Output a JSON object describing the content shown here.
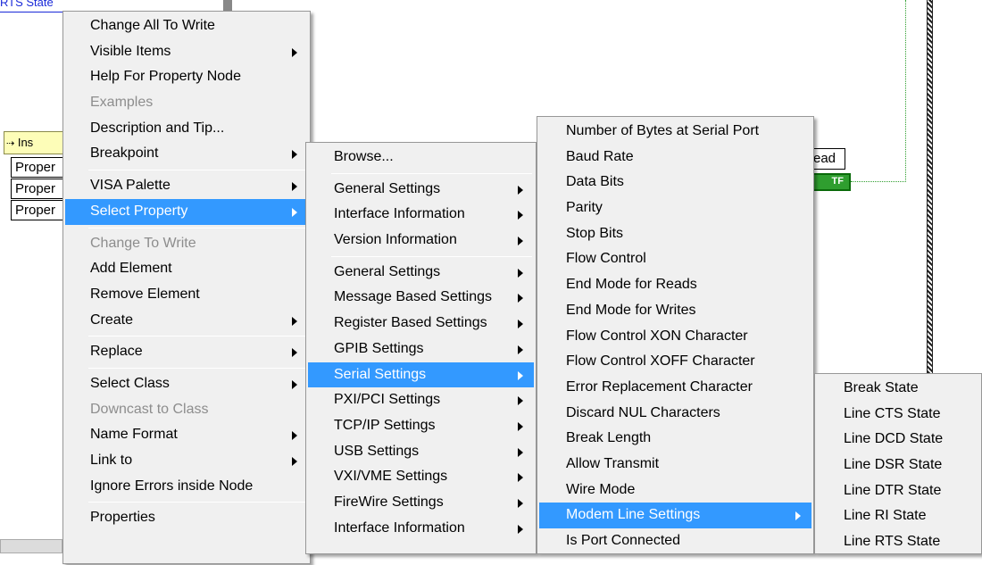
{
  "background": {
    "top_label": "RTS State",
    "node_header": "Ins",
    "node_header_glyph": "⇢",
    "property_rows": [
      "Proper",
      "Proper",
      "Proper"
    ],
    "read_label": "ead",
    "tf_label": "TF"
  },
  "main_menu": {
    "items": [
      {
        "label": "Change All To Write",
        "disabled": false
      },
      {
        "label": "Visible Items",
        "disabled": false,
        "submenu": true
      },
      {
        "label": "Help For Property Node",
        "disabled": false
      },
      {
        "label": "Examples",
        "disabled": true
      },
      {
        "label": "Description and Tip...",
        "disabled": false
      },
      {
        "label": "Breakpoint",
        "disabled": false,
        "submenu": true
      },
      {
        "sep": true
      },
      {
        "label": "VISA Palette",
        "disabled": false,
        "submenu": true
      },
      {
        "label": "Select Property",
        "disabled": false,
        "submenu": true,
        "selected": true
      },
      {
        "sep": true
      },
      {
        "label": "Change To Write",
        "disabled": true
      },
      {
        "label": "Add Element",
        "disabled": false
      },
      {
        "label": "Remove Element",
        "disabled": false
      },
      {
        "label": "Create",
        "disabled": false,
        "submenu": true
      },
      {
        "sep": true
      },
      {
        "label": "Replace",
        "disabled": false,
        "submenu": true
      },
      {
        "sep": true
      },
      {
        "label": "Select Class",
        "disabled": false,
        "submenu": true
      },
      {
        "label": "Downcast to Class",
        "disabled": true
      },
      {
        "label": "Name Format",
        "disabled": false,
        "submenu": true
      },
      {
        "label": "Link to",
        "disabled": false,
        "submenu": true
      },
      {
        "label": "Ignore Errors inside Node",
        "disabled": false
      },
      {
        "sep": true
      },
      {
        "label": "Properties",
        "disabled": false
      }
    ]
  },
  "select_property_menu": {
    "items": [
      {
        "label": "Browse..."
      },
      {
        "sep": true
      },
      {
        "label": "General Settings",
        "submenu": true
      },
      {
        "label": "Interface Information",
        "submenu": true
      },
      {
        "label": "Version Information",
        "submenu": true
      },
      {
        "sep": true
      },
      {
        "label": "General Settings",
        "submenu": true
      },
      {
        "label": "Message Based Settings",
        "submenu": true
      },
      {
        "label": "Register Based Settings",
        "submenu": true
      },
      {
        "label": "GPIB Settings",
        "submenu": true
      },
      {
        "label": "Serial Settings",
        "submenu": true,
        "selected": true
      },
      {
        "label": "PXI/PCI Settings",
        "submenu": true
      },
      {
        "label": "TCP/IP Settings",
        "submenu": true
      },
      {
        "label": "USB Settings",
        "submenu": true
      },
      {
        "label": "VXI/VME Settings",
        "submenu": true
      },
      {
        "label": "FireWire Settings",
        "submenu": true
      },
      {
        "label": "Interface Information",
        "submenu": true
      }
    ]
  },
  "serial_settings_menu": {
    "items": [
      {
        "label": "Number of Bytes at Serial Port"
      },
      {
        "label": "Baud Rate"
      },
      {
        "label": "Data Bits"
      },
      {
        "label": "Parity"
      },
      {
        "label": "Stop Bits"
      },
      {
        "label": "Flow Control"
      },
      {
        "label": "End Mode for Reads"
      },
      {
        "label": "End Mode for Writes"
      },
      {
        "label": "Flow Control XON Character"
      },
      {
        "label": "Flow Control XOFF Character"
      },
      {
        "label": "Error Replacement Character"
      },
      {
        "label": "Discard NUL Characters"
      },
      {
        "label": "Break Length"
      },
      {
        "label": "Allow Transmit"
      },
      {
        "label": "Wire Mode"
      },
      {
        "label": "Modem Line Settings",
        "submenu": true,
        "selected": true
      },
      {
        "label": "Is Port Connected"
      }
    ]
  },
  "modem_line_menu": {
    "items": [
      {
        "label": "Break State"
      },
      {
        "label": "Line CTS State"
      },
      {
        "label": "Line DCD State"
      },
      {
        "label": "Line DSR State"
      },
      {
        "label": "Line DTR State"
      },
      {
        "label": "Line RI State"
      },
      {
        "label": "Line RTS State"
      }
    ]
  },
  "colors": {
    "menu_bg": "#f0f0f0",
    "highlight": "#3399ff",
    "disabled_text": "#8d8d8d",
    "wire_blue": "#1a2ad8",
    "wire_green": "#2f9e2f"
  }
}
